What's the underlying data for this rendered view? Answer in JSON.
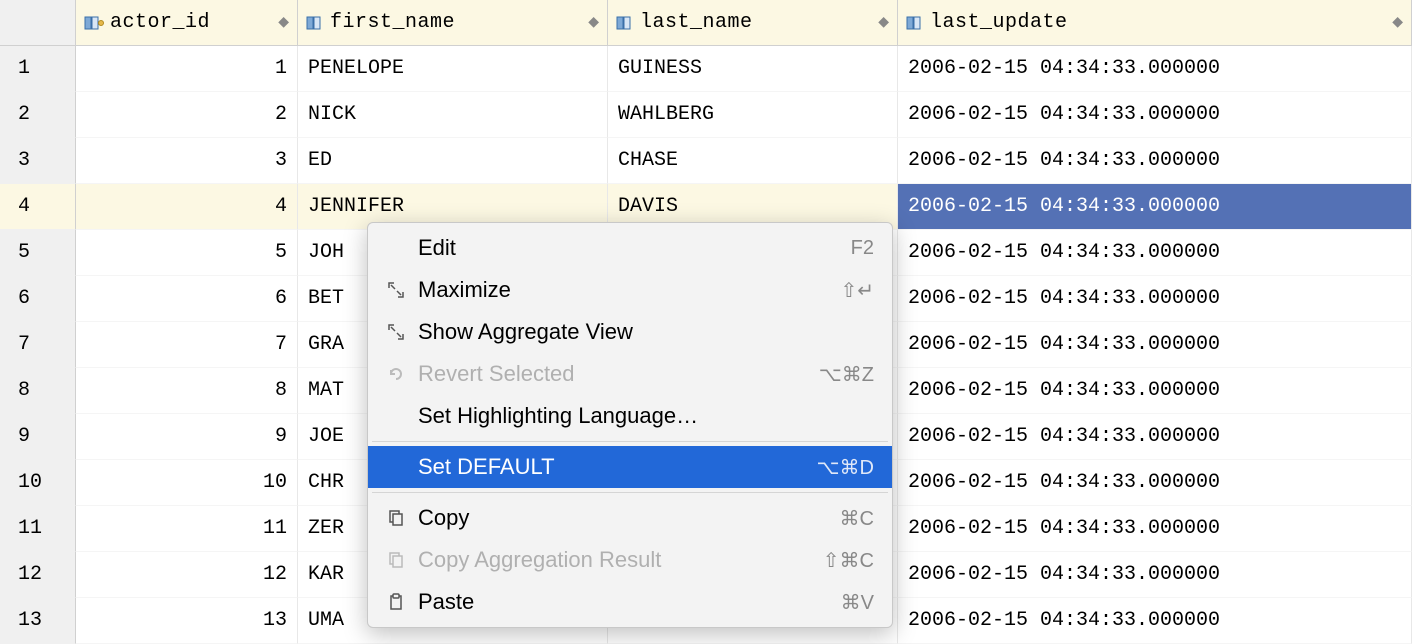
{
  "columns": [
    {
      "name": "actor_id",
      "pk": true
    },
    {
      "name": "first_name",
      "pk": false
    },
    {
      "name": "last_name",
      "pk": false
    },
    {
      "name": "last_update",
      "pk": false
    }
  ],
  "rows": [
    {
      "n": "1",
      "id": "1",
      "first": "PENELOPE",
      "last": "GUINESS",
      "upd": "2006-02-15 04:34:33.000000"
    },
    {
      "n": "2",
      "id": "2",
      "first": "NICK",
      "last": "WAHLBERG",
      "upd": "2006-02-15 04:34:33.000000"
    },
    {
      "n": "3",
      "id": "3",
      "first": "ED",
      "last": "CHASE",
      "upd": "2006-02-15 04:34:33.000000"
    },
    {
      "n": "4",
      "id": "4",
      "first": "JENNIFER",
      "last": "DAVIS",
      "upd": "2006-02-15 04:34:33.000000"
    },
    {
      "n": "5",
      "id": "5",
      "first": "JOH",
      "last": "",
      "upd": "2006-02-15 04:34:33.000000"
    },
    {
      "n": "6",
      "id": "6",
      "first": "BET",
      "last": "",
      "upd": "2006-02-15 04:34:33.000000"
    },
    {
      "n": "7",
      "id": "7",
      "first": "GRA",
      "last": "",
      "upd": "2006-02-15 04:34:33.000000"
    },
    {
      "n": "8",
      "id": "8",
      "first": "MAT",
      "last": "",
      "upd": "2006-02-15 04:34:33.000000"
    },
    {
      "n": "9",
      "id": "9",
      "first": "JOE",
      "last": "",
      "upd": "2006-02-15 04:34:33.000000"
    },
    {
      "n": "10",
      "id": "10",
      "first": "CHR",
      "last": "",
      "upd": "2006-02-15 04:34:33.000000"
    },
    {
      "n": "11",
      "id": "11",
      "first": "ZER",
      "last": "",
      "upd": "2006-02-15 04:34:33.000000"
    },
    {
      "n": "12",
      "id": "12",
      "first": "KAR",
      "last": "",
      "upd": "2006-02-15 04:34:33.000000"
    },
    {
      "n": "13",
      "id": "13",
      "first": "UMA",
      "last": "",
      "upd": "2006-02-15 04:34:33.000000"
    }
  ],
  "selected_row_index": 3,
  "menu": {
    "items": [
      {
        "label": "Edit",
        "shortcut": "F2",
        "icon": ""
      },
      {
        "label": "Maximize",
        "shortcut": "⇧↵",
        "icon": "expand"
      },
      {
        "label": "Show Aggregate View",
        "shortcut": "",
        "icon": "expand"
      },
      {
        "label": "Revert Selected",
        "shortcut": "⌥⌘Z",
        "icon": "undo",
        "disabled": true
      },
      {
        "label": "Set Highlighting Language…",
        "shortcut": "",
        "icon": ""
      },
      {
        "sep": true
      },
      {
        "label": "Set DEFAULT",
        "shortcut": "⌥⌘D",
        "icon": "",
        "highlight": true
      },
      {
        "sep": true
      },
      {
        "label": "Copy",
        "shortcut": "⌘C",
        "icon": "copy"
      },
      {
        "label": "Copy Aggregation Result",
        "shortcut": "⇧⌘C",
        "icon": "copy",
        "disabled": true
      },
      {
        "label": "Paste",
        "shortcut": "⌘V",
        "icon": "paste"
      }
    ]
  }
}
